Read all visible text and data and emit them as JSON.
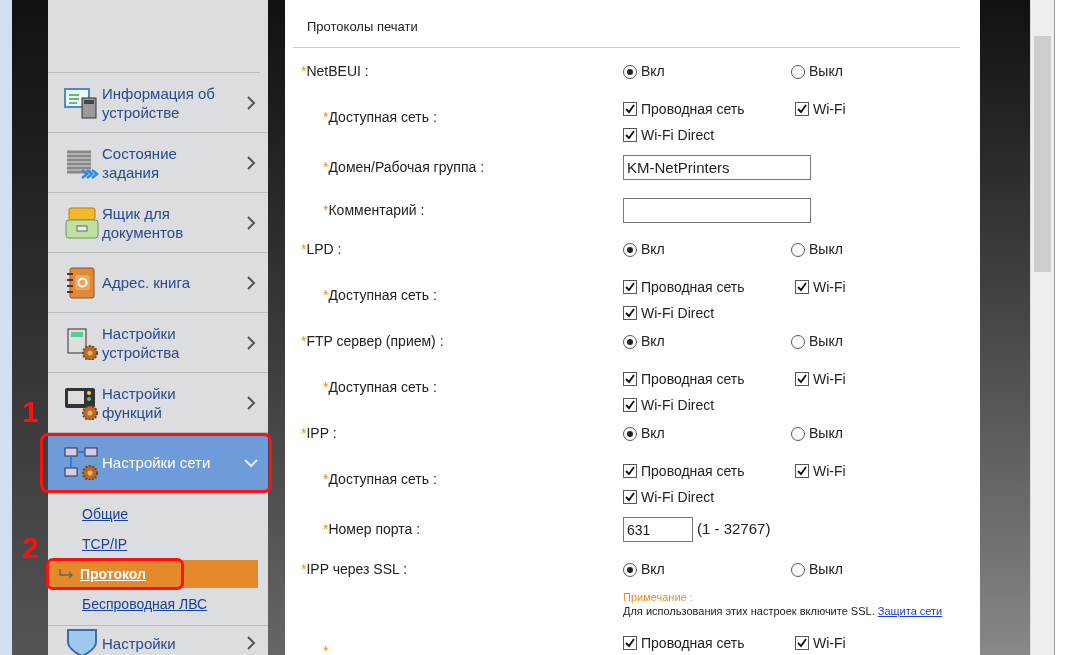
{
  "sidebar": {
    "items": [
      {
        "label": "Информация об устройстве",
        "expanded": false,
        "selected": false
      },
      {
        "label": "Состояние задания",
        "expanded": false,
        "selected": false
      },
      {
        "label": "Ящик для документов",
        "expanded": false,
        "selected": false
      },
      {
        "label": "Адрес. книга",
        "expanded": false,
        "selected": false
      },
      {
        "label": "Настройки устройства",
        "expanded": false,
        "selected": false
      },
      {
        "label": "Настройки функций",
        "expanded": false,
        "selected": false
      },
      {
        "label": "Настройки сети",
        "expanded": true,
        "selected": true,
        "callout": "1",
        "submenu": [
          {
            "label": "Общие",
            "selected": false
          },
          {
            "label": "TCP/IP",
            "selected": false
          },
          {
            "label": "Протокол",
            "selected": true,
            "callout": "2"
          },
          {
            "label": "Беспроводная ЛВС",
            "selected": false
          }
        ]
      },
      {
        "label": "Настройки",
        "expanded": false,
        "selected": false
      }
    ]
  },
  "content": {
    "title": "Протоколы печати",
    "protocols": [
      {
        "label": "NetBEUI :",
        "mark": "*",
        "options": [
          {
            "label": "Вкл",
            "selected": true
          },
          {
            "label": "Выкл",
            "selected": false
          }
        ],
        "children": [
          {
            "kind": "checks",
            "label": "Доступная сеть :",
            "mark": "*",
            "options": [
              {
                "label": "Проводная сеть",
                "checked": true
              },
              {
                "label": "Wi-Fi",
                "checked": true
              },
              {
                "label": "Wi-Fi Direct",
                "checked": true
              }
            ]
          },
          {
            "kind": "text",
            "label": "Домен/Рабочая группа :",
            "mark": "*",
            "value": "KM-NetPrinters"
          },
          {
            "kind": "text",
            "label": "Комментарий :",
            "mark": "*"
          }
        ]
      },
      {
        "label": "LPD :",
        "mark": "*",
        "options": [
          {
            "label": "Вкл",
            "selected": true
          },
          {
            "label": "Выкл",
            "selected": false
          }
        ],
        "children": [
          {
            "kind": "checks",
            "label": "Доступная сеть :",
            "mark": "*",
            "options": [
              {
                "label": "Проводная сеть",
                "checked": true
              },
              {
                "label": "Wi-Fi",
                "checked": true
              },
              {
                "label": "Wi-Fi Direct",
                "checked": true
              }
            ]
          }
        ]
      },
      {
        "label": "FTP сервер (прием) :",
        "mark": "*",
        "options": [
          {
            "label": "Вкл",
            "selected": true
          },
          {
            "label": "Выкл",
            "selected": false
          }
        ],
        "children": [
          {
            "kind": "checks",
            "label": "Доступная сеть :",
            "mark": "*",
            "options": [
              {
                "label": "Проводная сеть",
                "checked": true
              },
              {
                "label": "Wi-Fi",
                "checked": true
              },
              {
                "label": "Wi-Fi Direct",
                "checked": true
              }
            ]
          }
        ]
      },
      {
        "label": "IPP :",
        "mark": "*",
        "options": [
          {
            "label": "Вкл",
            "selected": true
          },
          {
            "label": "Выкл",
            "selected": false
          }
        ],
        "children": [
          {
            "kind": "checks",
            "label": "Доступная сеть :",
            "mark": "*",
            "options": [
              {
                "label": "Проводная сеть",
                "checked": true
              },
              {
                "label": "Wi-Fi",
                "checked": true
              },
              {
                "label": "Wi-Fi Direct",
                "checked": true
              }
            ]
          },
          {
            "kind": "port",
            "label": "Номер порта :",
            "mark": "*",
            "value": "631",
            "range": "(1 - 32767)"
          }
        ]
      },
      {
        "label": "IPP через SSL :",
        "mark": "*",
        "options": [
          {
            "label": "Вкл",
            "selected": true
          },
          {
            "label": "Выкл",
            "selected": false
          }
        ],
        "children": [
          {
            "kind": "note",
            "title": "Примечание :",
            "text": "Для использования этих настроек включите SSL.",
            "link": "Защита сети"
          },
          {
            "kind": "checks",
            "mark": "*",
            "options": [
              {
                "label": "Проводная сеть",
                "checked": true
              },
              {
                "label": "Wi-Fi",
                "checked": true
              }
            ]
          }
        ]
      }
    ]
  }
}
